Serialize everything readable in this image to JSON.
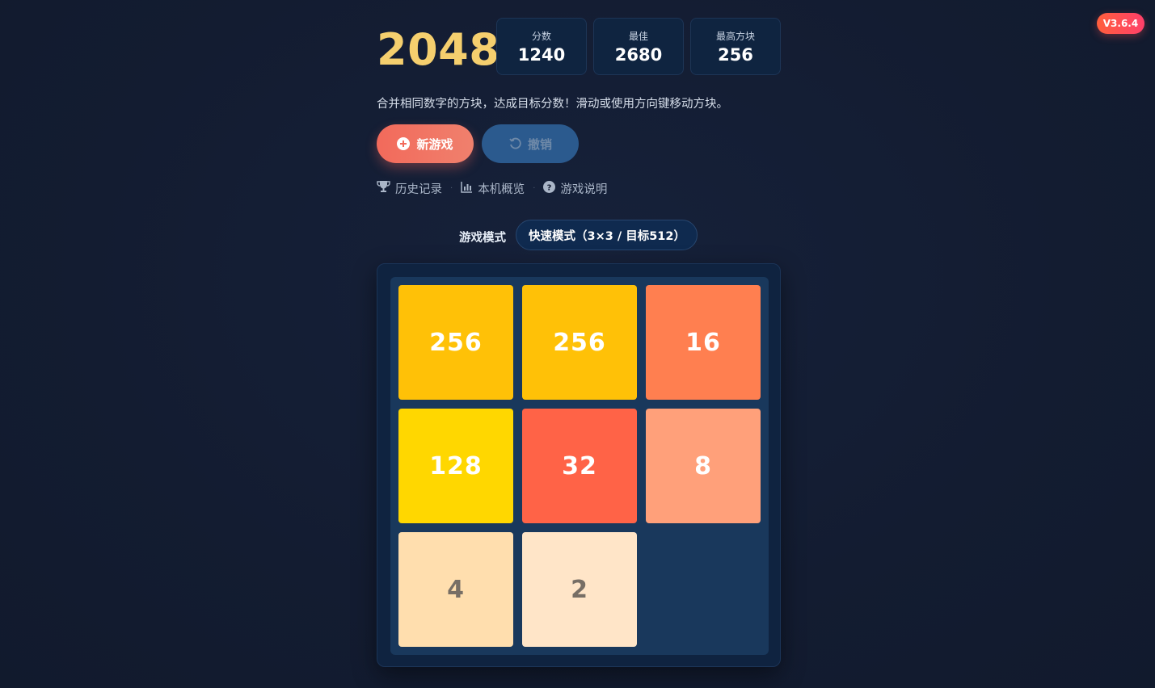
{
  "version": "V3.6.4",
  "game": {
    "title": "2048",
    "scores": [
      {
        "label": "分数",
        "value": "1240"
      },
      {
        "label": "最佳",
        "value": "2680"
      },
      {
        "label": "最高方块",
        "value": "256"
      }
    ],
    "description": "合并相同数字的方块，达成目标分数！滑动或使用方向键移动方块。"
  },
  "buttons": {
    "new_game": "新游戏",
    "undo": "撤销"
  },
  "links": [
    {
      "label": "历史记录",
      "icon": "trophy-icon"
    },
    {
      "label": "本机概览",
      "icon": "bar-chart-icon"
    },
    {
      "label": "游戏说明",
      "icon": "help-icon"
    }
  ],
  "mode": {
    "label": "游戏模式",
    "selected": "快速模式（3×3 / 目标512）"
  },
  "board": {
    "rows": 3,
    "cols": 3,
    "tiles": [
      {
        "row": 0,
        "col": 0,
        "value": "256",
        "bg": "#ffc107",
        "fg": "#ffffff"
      },
      {
        "row": 0,
        "col": 1,
        "value": "256",
        "bg": "#ffc107",
        "fg": "#ffffff"
      },
      {
        "row": 0,
        "col": 2,
        "value": "16",
        "bg": "#ff7f50",
        "fg": "#ffffff"
      },
      {
        "row": 1,
        "col": 0,
        "value": "128",
        "bg": "#ffd700",
        "fg": "#ffffff"
      },
      {
        "row": 1,
        "col": 1,
        "value": "32",
        "bg": "#ff6347",
        "fg": "#ffffff"
      },
      {
        "row": 1,
        "col": 2,
        "value": "8",
        "bg": "#ffa07a",
        "fg": "#ffffff"
      },
      {
        "row": 2,
        "col": 0,
        "value": "4",
        "bg": "#ffdeae",
        "fg": "#776e65"
      },
      {
        "row": 2,
        "col": 1,
        "value": "2",
        "bg": "#ffe5c8",
        "fg": "#776e65"
      }
    ]
  }
}
